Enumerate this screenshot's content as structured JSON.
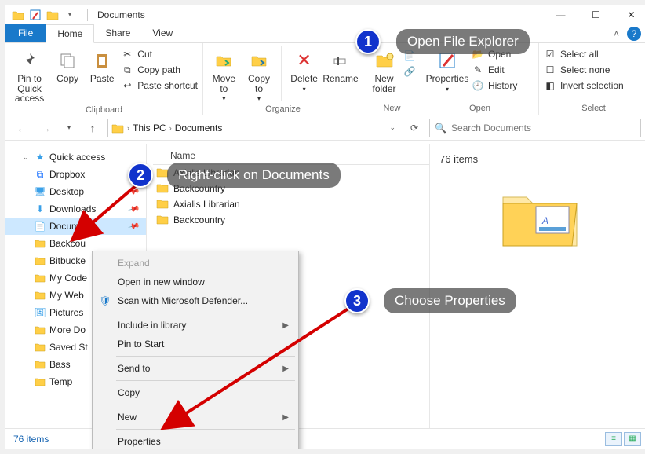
{
  "window": {
    "title": "Documents",
    "controls": {
      "min": "—",
      "max": "☐",
      "close": "✕"
    }
  },
  "tabs": {
    "file": "File",
    "home": "Home",
    "share": "Share",
    "view": "View"
  },
  "ribbon": {
    "clipboard": {
      "label": "Clipboard",
      "pin": "Pin to Quick\naccess",
      "copy": "Copy",
      "paste": "Paste",
      "cut": "Cut",
      "copy_path": "Copy path",
      "paste_shortcut": "Paste shortcut"
    },
    "organize": {
      "label": "Organize",
      "move_to": "Move\nto",
      "copy_to": "Copy\nto",
      "delete": "Delete",
      "rename": "Rename"
    },
    "new": {
      "label": "New",
      "new_folder": "New\nfolder"
    },
    "open": {
      "label": "Open",
      "properties": "Properties",
      "open": "Open",
      "edit": "Edit",
      "history": "History"
    },
    "select": {
      "label": "Select",
      "select_all": "Select all",
      "select_none": "Select none",
      "invert": "Invert selection"
    }
  },
  "breadcrumb": {
    "root": "This PC",
    "current": "Documents"
  },
  "search": {
    "placeholder": "Search Documents"
  },
  "nav": {
    "quick_access": "Quick access",
    "items": [
      {
        "label": "Dropbox"
      },
      {
        "label": "Desktop"
      },
      {
        "label": "Downloads"
      },
      {
        "label": "Documents"
      },
      {
        "label": "Backcou"
      },
      {
        "label": "Bitbucke"
      },
      {
        "label": "My Code"
      },
      {
        "label": "My Web"
      },
      {
        "label": "Pictures"
      },
      {
        "label": "More Do"
      },
      {
        "label": "Saved St"
      },
      {
        "label": "Bass"
      },
      {
        "label": "Temp"
      }
    ]
  },
  "content": {
    "column": "Name",
    "rows": [
      "Axialis Librarian",
      "Backcountry",
      "Axialis Librarian",
      "Backcountry"
    ]
  },
  "preview": {
    "count_label": "76 items"
  },
  "status": {
    "count": "76 items"
  },
  "context_menu": {
    "expand": "Expand",
    "open_new": "Open in new window",
    "scan": "Scan with Microsoft Defender...",
    "include_lib": "Include in library",
    "pin_start": "Pin to Start",
    "send_to": "Send to",
    "copy": "Copy",
    "new": "New",
    "properties": "Properties"
  },
  "annotations": {
    "a1": {
      "num": "1",
      "text": "Open File Explorer"
    },
    "a2": {
      "num": "2",
      "text": "Right-click on Documents"
    },
    "a3": {
      "num": "3",
      "text": "Choose Properties"
    }
  }
}
